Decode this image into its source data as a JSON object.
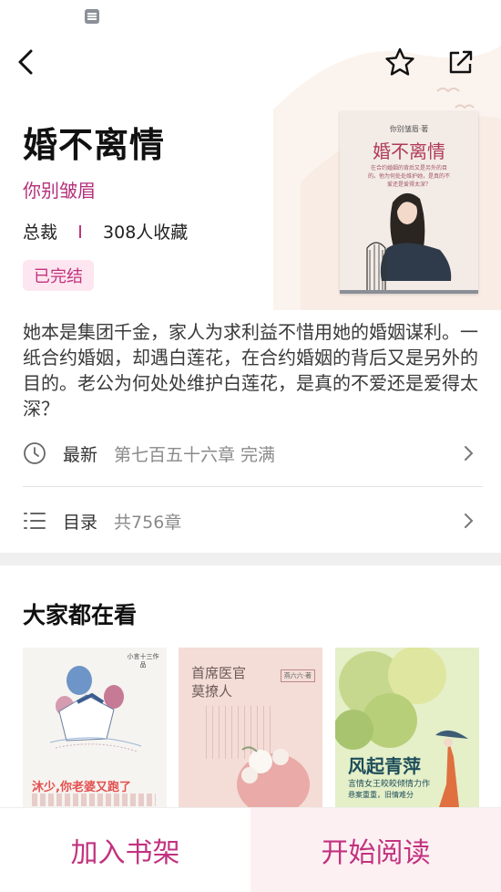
{
  "book": {
    "title": "婚不离情",
    "author": "你别皱眉",
    "genre": "总裁",
    "favorites": "308人收藏",
    "status": "已完结",
    "cover": {
      "author_line": "你别皱眉·著",
      "title": "婚不离情",
      "tagline": "在合约婚姻的背后又是另外的目的。他为何处处维护她，是真的不爱还是爱得太深？"
    },
    "description": "她本是集团千金，家人为求利益不惜用她的婚姻谋利。一纸合约婚姻，却遇白莲花，在合约婚姻的背后又是另外的目的。老公为何处处维护白莲花，是真的不爱还是爱得太深？"
  },
  "latest": {
    "label": "最新",
    "value": "第七百五十六章 完满"
  },
  "toc": {
    "label": "目录",
    "value": "共756章"
  },
  "recommend": {
    "title": "大家都在看",
    "items": [
      {
        "cover_title": "沐少,你老婆又跑了",
        "cover_tag": "小言十三作品"
      },
      {
        "cover_title": "首席医官莫撩人",
        "cover_tag": "燕六六·著"
      },
      {
        "cover_title": "风起青萍",
        "cover_sub": "言情女王皎皎倾情力作",
        "cover_sub2": "悬案重重，旧情难分"
      }
    ]
  },
  "actions": {
    "add_shelf": "加入书架",
    "start_read": "开始阅读"
  },
  "colors": {
    "accent": "#c2327f",
    "badge_bg": "#fde6ef"
  }
}
